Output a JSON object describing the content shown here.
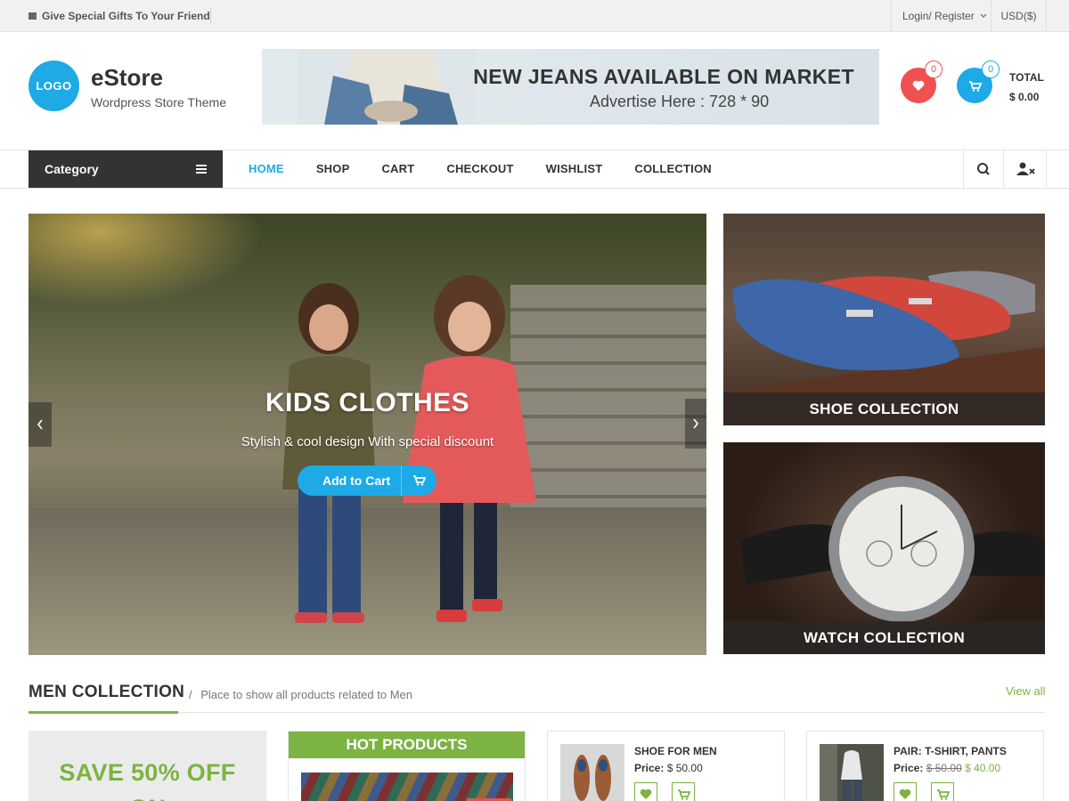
{
  "topbar": {
    "promo": "Give Special Gifts To Your Friend",
    "login": "Login/ Register",
    "currency": "USD($)"
  },
  "header": {
    "logo_text": "LOGO",
    "site_title": "eStore",
    "tagline": "Wordpress Store Theme",
    "banner_title": "NEW JEANS AVAILABLE ON MARKET",
    "banner_sub": "Advertise Here : 728 * 90",
    "wishlist_count": "0",
    "cart_count": "0",
    "total_label": "TOTAL",
    "total_value": "$ 0.00"
  },
  "nav": {
    "category": "Category",
    "items": [
      "HOME",
      "SHOP",
      "CART",
      "CHECKOUT",
      "WISHLIST",
      "COLLECTION"
    ],
    "active": "HOME"
  },
  "slider": {
    "title": "KIDS CLOTHES",
    "subtitle": "Stylish & cool design With special discount",
    "button": "Add to Cart"
  },
  "tiles": {
    "shoe": "SHOE COLLECTION",
    "watch": "WATCH COLLECTION"
  },
  "section": {
    "title": "MEN COLLECTION",
    "desc": "Place to show all products related to Men",
    "view_all": "View all",
    "separator": "/"
  },
  "promo_box": {
    "text": "SAVE 50% OFF",
    "extra": "ON"
  },
  "hot": {
    "title": "HOT PRODUCTS"
  },
  "products": [
    {
      "name": "SHOE FOR MEN",
      "price_label": "Price:",
      "price": "$ 50.00"
    },
    {
      "name": "PAIR: T-SHIRT, PANTS",
      "price_label": "Price:",
      "old_price": "$ 50.00",
      "price": "$ 40.00"
    }
  ],
  "colors": {
    "accent_blue": "#1daae6",
    "accent_green": "#7cb342",
    "accent_red": "#ef5151",
    "dark": "#333333"
  }
}
